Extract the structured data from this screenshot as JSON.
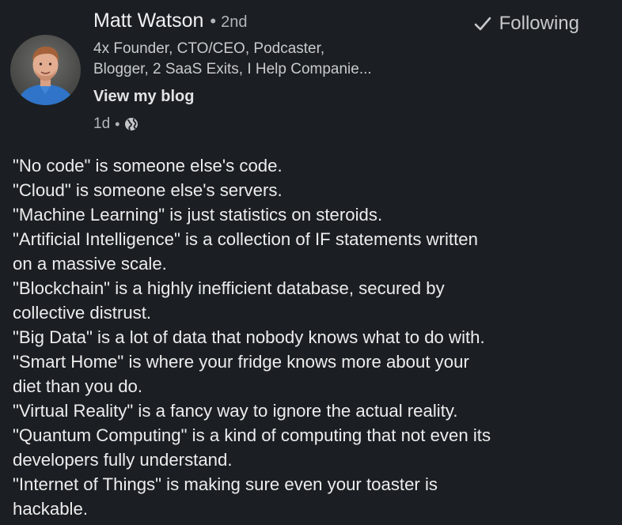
{
  "author": {
    "name": "Matt Watson",
    "separator": "•",
    "degree": "2nd",
    "headline_lines": [
      "4x Founder, CTO/CEO, Podcaster,",
      "Blogger, 2 SaaS Exits, I Help Companie..."
    ],
    "blog_link": "View my blog",
    "time": "1d",
    "visibility_icon": "globe-icon",
    "avatar_icon": "profile-photo"
  },
  "follow": {
    "label": "Following",
    "icon": "checkmark-icon"
  },
  "post": {
    "lines": [
      "\"No code\" is someone else's code.",
      "\"Cloud\" is someone else's servers.",
      "\"Machine Learning\" is just statistics on steroids.",
      "\"Artificial Intelligence\" is a collection of IF statements written",
      "on a massive scale.",
      "\"Blockchain\" is a highly inefficient database, secured by",
      "collective distrust.",
      "\"Big Data\" is a lot of data that nobody knows what to do with.",
      "\"Smart Home\" is where your fridge knows more about your",
      "diet than you do.",
      "\"Virtual Reality\" is a fancy way to ignore the actual reality.",
      "\"Quantum Computing\" is a kind of computing that not even its",
      "developers fully understand.",
      "\"Internet of Things\" is making sure even your toaster is",
      "hackable."
    ]
  },
  "colors": {
    "background": "#1b1f23",
    "text": "#e8e9ea",
    "secondary_text": "#b3b6b9"
  }
}
